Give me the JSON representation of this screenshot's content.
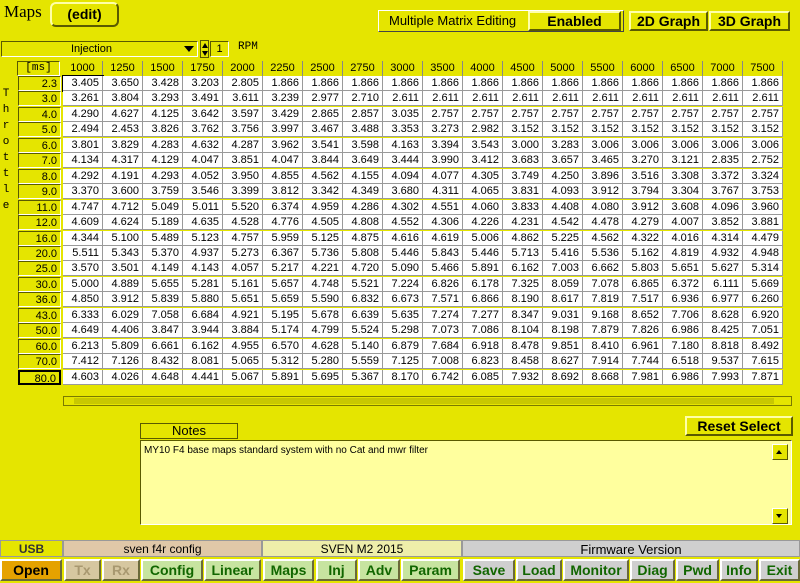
{
  "header": {
    "title": "Maps",
    "edit_label": "(edit)",
    "multi_matrix_label": "Multiple Matrix Editing",
    "enabled_label": "Enabled",
    "graph2d_label": "2D Graph",
    "graph3d_label": "3D Graph"
  },
  "selector": {
    "map_name": "Injection",
    "index_value": "1",
    "x_axis_label": "RPM",
    "unit_label": "[ms]",
    "y_axis_label": "Throttle"
  },
  "table": {
    "rpm": [
      "1000",
      "1250",
      "1500",
      "1750",
      "2000",
      "2250",
      "2500",
      "2750",
      "3000",
      "3500",
      "4000",
      "4500",
      "5000",
      "5500",
      "6000",
      "6500",
      "7000",
      "7500"
    ],
    "throttle": [
      "2.3",
      "3.0",
      "4.0",
      "5.0",
      "6.0",
      "7.0",
      "8.0",
      "9.0",
      "11.0",
      "12.0",
      "16.0",
      "20.0",
      "25.0",
      "30.0",
      "36.0",
      "43.0",
      "50.0",
      "60.0",
      "70.0",
      "80.0"
    ],
    "rows": [
      [
        "3.405",
        "3.650",
        "3.428",
        "3.203",
        "2.805",
        "1.866",
        "1.866",
        "1.866",
        "1.866",
        "1.866",
        "1.866",
        "1.866",
        "1.866",
        "1.866",
        "1.866",
        "1.866",
        "1.866",
        "1.866"
      ],
      [
        "3.261",
        "3.804",
        "3.293",
        "3.491",
        "3.611",
        "3.239",
        "2.977",
        "2.710",
        "2.611",
        "2.611",
        "2.611",
        "2.611",
        "2.611",
        "2.611",
        "2.611",
        "2.611",
        "2.611",
        "2.611"
      ],
      [
        "4.290",
        "4.627",
        "4.125",
        "3.642",
        "3.597",
        "3.429",
        "2.865",
        "2.857",
        "3.035",
        "2.757",
        "2.757",
        "2.757",
        "2.757",
        "2.757",
        "2.757",
        "2.757",
        "2.757",
        "2.757"
      ],
      [
        "2.494",
        "2.453",
        "3.826",
        "3.762",
        "3.756",
        "3.997",
        "3.467",
        "3.488",
        "3.353",
        "3.273",
        "2.982",
        "3.152",
        "3.152",
        "3.152",
        "3.152",
        "3.152",
        "3.152",
        "3.152"
      ],
      [
        "3.801",
        "3.829",
        "4.283",
        "4.632",
        "4.287",
        "3.962",
        "3.541",
        "3.598",
        "4.163",
        "3.394",
        "3.543",
        "3.000",
        "3.283",
        "3.006",
        "3.006",
        "3.006",
        "3.006",
        "3.006"
      ],
      [
        "4.134",
        "4.317",
        "4.129",
        "4.047",
        "3.851",
        "4.047",
        "3.844",
        "3.649",
        "3.444",
        "3.990",
        "3.412",
        "3.683",
        "3.657",
        "3.465",
        "3.270",
        "3.121",
        "2.835",
        "2.752"
      ],
      [
        "4.292",
        "4.191",
        "4.293",
        "4.052",
        "3.950",
        "4.855",
        "4.562",
        "4.155",
        "4.094",
        "4.077",
        "4.305",
        "3.749",
        "4.250",
        "3.896",
        "3.516",
        "3.308",
        "3.372",
        "3.324"
      ],
      [
        "3.370",
        "3.600",
        "3.759",
        "3.546",
        "3.399",
        "3.812",
        "3.342",
        "4.349",
        "3.680",
        "4.311",
        "4.065",
        "3.831",
        "4.093",
        "3.912",
        "3.794",
        "3.304",
        "3.767",
        "3.753"
      ],
      [
        "4.747",
        "4.712",
        "5.049",
        "5.011",
        "5.520",
        "6.374",
        "4.959",
        "4.286",
        "4.302",
        "4.551",
        "4.060",
        "3.833",
        "4.408",
        "4.080",
        "3.912",
        "3.608",
        "4.096",
        "3.960"
      ],
      [
        "4.609",
        "4.624",
        "5.189",
        "4.635",
        "4.528",
        "4.776",
        "4.505",
        "4.808",
        "4.552",
        "4.306",
        "4.226",
        "4.231",
        "4.542",
        "4.478",
        "4.279",
        "4.007",
        "3.852",
        "3.881"
      ],
      [
        "4.344",
        "5.100",
        "5.489",
        "5.123",
        "4.757",
        "5.959",
        "5.125",
        "4.875",
        "4.616",
        "4.619",
        "5.006",
        "4.862",
        "5.225",
        "4.562",
        "4.322",
        "4.016",
        "4.314",
        "4.479"
      ],
      [
        "5.511",
        "5.343",
        "5.370",
        "4.937",
        "5.273",
        "6.367",
        "5.736",
        "5.808",
        "5.446",
        "5.843",
        "5.446",
        "5.713",
        "5.416",
        "5.536",
        "5.162",
        "4.819",
        "4.932",
        "4.948"
      ],
      [
        "3.570",
        "3.501",
        "4.149",
        "4.143",
        "4.057",
        "5.217",
        "4.221",
        "4.720",
        "5.090",
        "5.466",
        "5.891",
        "6.162",
        "7.003",
        "6.662",
        "5.803",
        "5.651",
        "5.627",
        "5.314"
      ],
      [
        "5.000",
        "4.889",
        "5.655",
        "5.281",
        "5.161",
        "5.657",
        "4.748",
        "5.521",
        "7.224",
        "6.826",
        "6.178",
        "7.325",
        "8.059",
        "7.078",
        "6.865",
        "6.372",
        "6.111",
        "5.669"
      ],
      [
        "4.850",
        "3.912",
        "5.839",
        "5.880",
        "5.651",
        "5.659",
        "5.590",
        "6.832",
        "6.673",
        "7.571",
        "6.866",
        "8.190",
        "8.617",
        "7.819",
        "7.517",
        "6.936",
        "6.977",
        "6.260"
      ],
      [
        "6.333",
        "6.029",
        "7.058",
        "6.684",
        "4.921",
        "5.195",
        "5.678",
        "6.639",
        "5.635",
        "7.274",
        "7.277",
        "8.347",
        "9.031",
        "9.168",
        "8.652",
        "7.706",
        "8.628",
        "6.920"
      ],
      [
        "4.649",
        "4.406",
        "3.847",
        "3.944",
        "3.884",
        "5.174",
        "4.799",
        "5.524",
        "5.298",
        "7.073",
        "7.086",
        "8.104",
        "8.198",
        "7.879",
        "7.826",
        "6.986",
        "8.425",
        "7.051"
      ],
      [
        "6.213",
        "5.809",
        "6.661",
        "6.162",
        "4.955",
        "6.570",
        "4.628",
        "5.140",
        "6.879",
        "7.684",
        "6.918",
        "8.478",
        "9.851",
        "8.410",
        "6.961",
        "7.180",
        "8.818",
        "8.492"
      ],
      [
        "7.412",
        "7.126",
        "8.432",
        "8.081",
        "5.065",
        "5.312",
        "5.280",
        "5.559",
        "7.125",
        "7.008",
        "6.823",
        "8.458",
        "8.627",
        "7.914",
        "7.744",
        "6.518",
        "9.537",
        "7.615"
      ],
      [
        "4.603",
        "4.026",
        "4.648",
        "4.441",
        "5.067",
        "5.891",
        "5.695",
        "5.367",
        "8.170",
        "6.742",
        "6.085",
        "7.932",
        "8.692",
        "8.668",
        "7.981",
        "6.986",
        "7.993",
        "7.871"
      ]
    ]
  },
  "notes": {
    "label": "Notes",
    "reset_label": "Reset Select",
    "text": "MY10 F4 base maps standard system with no Cat and mwr filter"
  },
  "status": {
    "usb": "USB",
    "config_name": "sven f4r config",
    "device": "SVEN M2 2015",
    "firmware": "Firmware Version"
  },
  "buttons": {
    "open": "Open",
    "tx": "Tx",
    "rx": "Rx",
    "config": "Config",
    "linear": "Linear",
    "maps": "Maps",
    "inj": "Inj",
    "adv": "Adv",
    "param": "Param",
    "save": "Save",
    "load": "Load",
    "monitor": "Monitor",
    "diag": "Diag",
    "pwd": "Pwd",
    "info": "Info",
    "exit": "Exit"
  },
  "colors": {
    "background": "#e5e500",
    "cell": "#ffffff",
    "notes_bg": "#ffff9e"
  }
}
